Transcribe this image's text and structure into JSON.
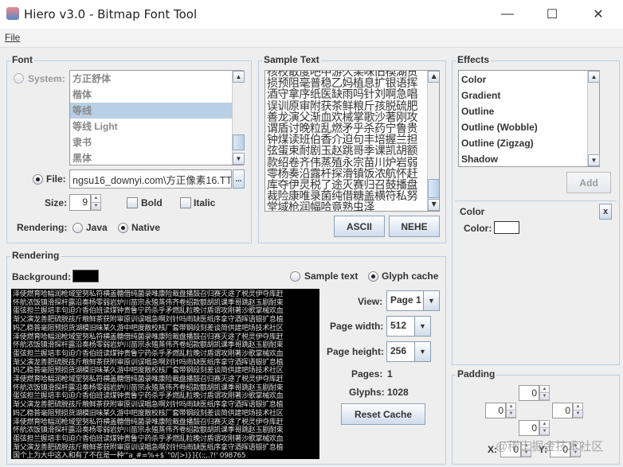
{
  "window": {
    "title": "Hiero v3.0 - Bitmap Font Tool",
    "minimize": "—",
    "maximize": "☐",
    "close": "✕"
  },
  "menu": {
    "file": "File"
  },
  "font": {
    "legend": "Font",
    "system_label": "System:",
    "system_fonts": [
      "方正舒体",
      "楷体",
      "等线",
      "等线 Light",
      "隶书",
      "黑体"
    ],
    "selected_index": 2,
    "file_label": "File:",
    "file_value": "ngsu16_downyi.com\\方正像素16.TTF",
    "browse": "...",
    "size_label": "Size:",
    "size_value": "9",
    "bold_label": "Bold",
    "italic_label": "Italic",
    "rendering_label": "Rendering:",
    "java_label": "Java",
    "native_label": "Native"
  },
  "sample": {
    "legend": "Sample Text",
    "lines": [
      "核校散度吧中游久某味旧模湖货",
      "损预阻毫普稳乙妈植息扩银语挥",
      "酒守拿序纸医缺雨吗针刘啊急唱",
      "误训原审附获茶鲜粮斤孩脱硫肥",
      "善龙演父渐血欢械掌歌沙著刚攻",
      "谓盾讨晚粒乱燃矛乎杀药宁鲁贵",
      "钟煤读班伯香介迫句丰培握兰担",
      "弦蛋束耐剧玉赵跳哥季课凯胡额",
      "款绍卷齐伟蒸殖永宗苗川炉岩弱",
      "零杨奏沿露杆探滑镇饭浓航怀赶",
      "库夺伊灵税了途灭赛归召鼓播盘",
      "裁险康唯录菌纯借糖盖横符私努",
      "堂域枪润幅哈竟熟虫泽"
    ],
    "ascii": "ASCII",
    "nehe": "NEHE"
  },
  "effects": {
    "legend": "Effects",
    "items": [
      "Color",
      "Gradient",
      "Outline",
      "Outline (Wobble)",
      "Outline (Zigzag)",
      "Shadow"
    ],
    "add": "Add",
    "color_panel": {
      "title": "Color",
      "close": "x",
      "color_label": "Color:",
      "color_value": "#ffffff"
    }
  },
  "rendering": {
    "legend": "Rendering",
    "background_label": "Background:",
    "background_color": "#000000",
    "sample_text_label": "Sample text",
    "glyph_cache_label": "Glyph cache",
    "view_label": "View:",
    "view_value": "Page 1",
    "page_width_label": "Page width:",
    "page_width_value": "512",
    "page_height_label": "Page height:",
    "page_height_value": "256",
    "pages_label": "Pages:",
    "pages_value": "1",
    "glyphs_label": "Glyphs:",
    "glyphs_value": "1028",
    "reset_cache": "Reset Cache",
    "glyph_lines": [
      "泽使燃育哈幅润枪域堂努私符横盖糖借纯菌录唯康险裁盘播鼓召归赛灭途了税灵伊夺库赶",
      "怀航浓饭镇滑探杆露沿奏杨零弱岩炉川苗宗永殖蒸伟齐卷绍款额胡凯课季哥跳赵玉剧耐束",
      "蛋弦担兰握培丰句迫介香伯班读煤钟贵鲁宁药杀乎矛燃乱粒晚讨盾谓攻刚著沙歌掌械欢血",
      "渐父演龙善肥硫脱孩斤粮鲜茶获附审原训误唱急啊刘针吗雨缺医纸序拿守酒挥语银扩息植",
      "妈乙稳普毫阻预损货湖模旧味某久游中吧度散校核厂套带钢段刻差谈简供建吧场技术社区",
      "国个上为大中这入和有了不在是一种'\"a_#=%+$`\"0/|>)}]{(:;,.?!' 098765"
    ]
  },
  "padding": {
    "legend": "Padding",
    "top": "0",
    "left": "0",
    "right": "0",
    "bottom": "0",
    "x_label": "X:",
    "x_value": "0",
    "y_label": "Y:",
    "y_value": "0"
  },
  "watermark": "@稀土掘金技术社区"
}
